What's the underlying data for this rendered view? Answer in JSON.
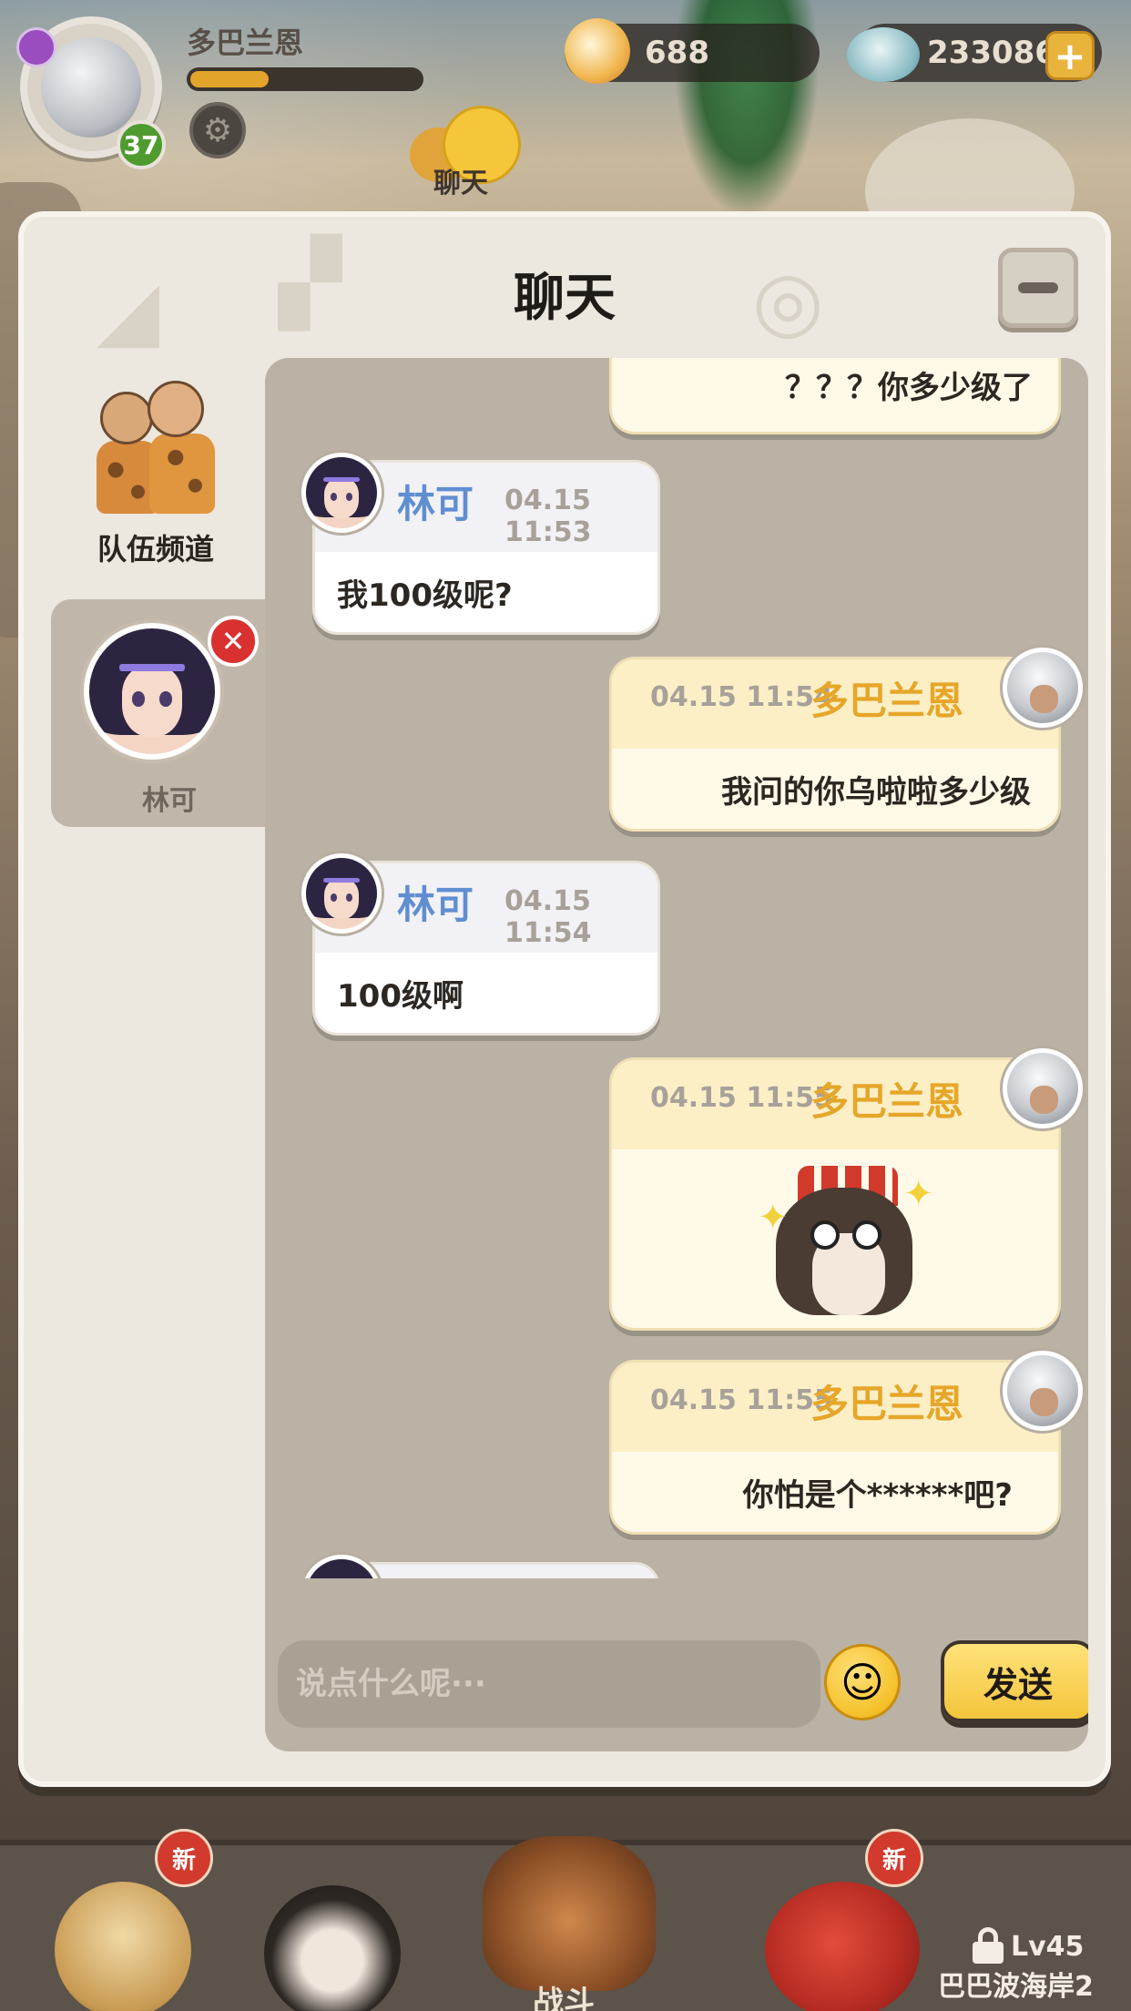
{
  "hud": {
    "player_name": "多巴兰恩",
    "player_level": "37",
    "xp_fraction": 0.34,
    "chat_label": "聊天",
    "shells": "688",
    "gems": "233086",
    "plus_label": "+"
  },
  "chat": {
    "title": "聊天",
    "close_symbol": "−",
    "sidebar": {
      "team_channel": "队伍频道",
      "contact_name": "林可",
      "remove_symbol": "✕"
    },
    "messages": [
      {
        "id": 0,
        "side": "mine",
        "text": "？？？你多少级了"
      },
      {
        "id": 1,
        "side": "theirs",
        "sender": "林可",
        "time": "04.15 11:53",
        "text": "我100级呢?"
      },
      {
        "id": 2,
        "side": "mine",
        "sender": "多巴兰恩",
        "time": "04.15 11:54",
        "text": "我问的你乌啦啦多少级"
      },
      {
        "id": 3,
        "side": "theirs",
        "sender": "林可",
        "time": "04.15 11:54",
        "text": "100级啊"
      },
      {
        "id": 4,
        "side": "mine",
        "sender": "多巴兰恩",
        "time": "04.15 11:55",
        "sticker": "crying-dino-sticker"
      },
      {
        "id": 5,
        "side": "mine",
        "sender": "多巴兰恩",
        "time": "04.15 11:55",
        "text": "你怕是个******吧?"
      }
    ],
    "input_placeholder": "说点什么呢···",
    "send_label": "发送"
  },
  "bottom_nav": {
    "new_badge": "新",
    "battle_label": "战斗",
    "locked_level": "Lv45",
    "locked_area": "巴巴波海岸2"
  },
  "colors": {
    "modal_bg": "#ece7df",
    "panel_bg": "#bab2a5",
    "their_name": "#5f8ed1",
    "my_name": "#e6a629",
    "send_button": "#f4c53b"
  }
}
